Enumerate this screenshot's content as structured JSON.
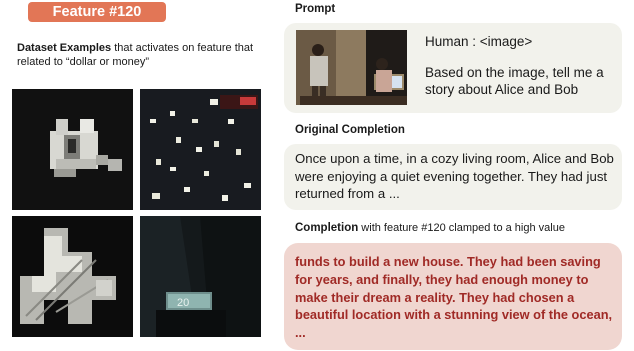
{
  "feature_badge": "Feature #120",
  "left_panel": {
    "desc_bold": "Dataset Examples",
    "desc_rest": " that activates on feature that related to “dollar or money”",
    "tiles": [
      {
        "name": "tile-1",
        "content": "currency-fragment-dark"
      },
      {
        "name": "tile-2",
        "content": "poster-text-fragments"
      },
      {
        "name": "tile-3",
        "content": "banknote-diagonal"
      },
      {
        "name": "tile-4",
        "content": "suit-pocket-banknote"
      }
    ],
    "tile4_note_text": "20"
  },
  "prompt_section": {
    "label": "Prompt",
    "line1": "Human : <image>",
    "line2": "Based on the image, tell me a story about Alice and Bob"
  },
  "original_section": {
    "label": "Original Completion",
    "text": "Once upon a time, in a cozy living room, Alice and Bob were enjoying a quiet evening together. They had just returned from a ..."
  },
  "clamped_section": {
    "label_bold": "Completion",
    "label_rest": " with feature #120 clamped to a high value",
    "text": "funds to build a new house. They had been saving for years, and finally, they had enough money to make their dream a reality. They had chosen a beautiful location with a stunning view of the ocean, ..."
  },
  "colors": {
    "badge": "#e27656",
    "prompt_box": "#f2f2ec",
    "clamped_box": "#f0d6d0",
    "clamped_text": "#a02a26"
  }
}
